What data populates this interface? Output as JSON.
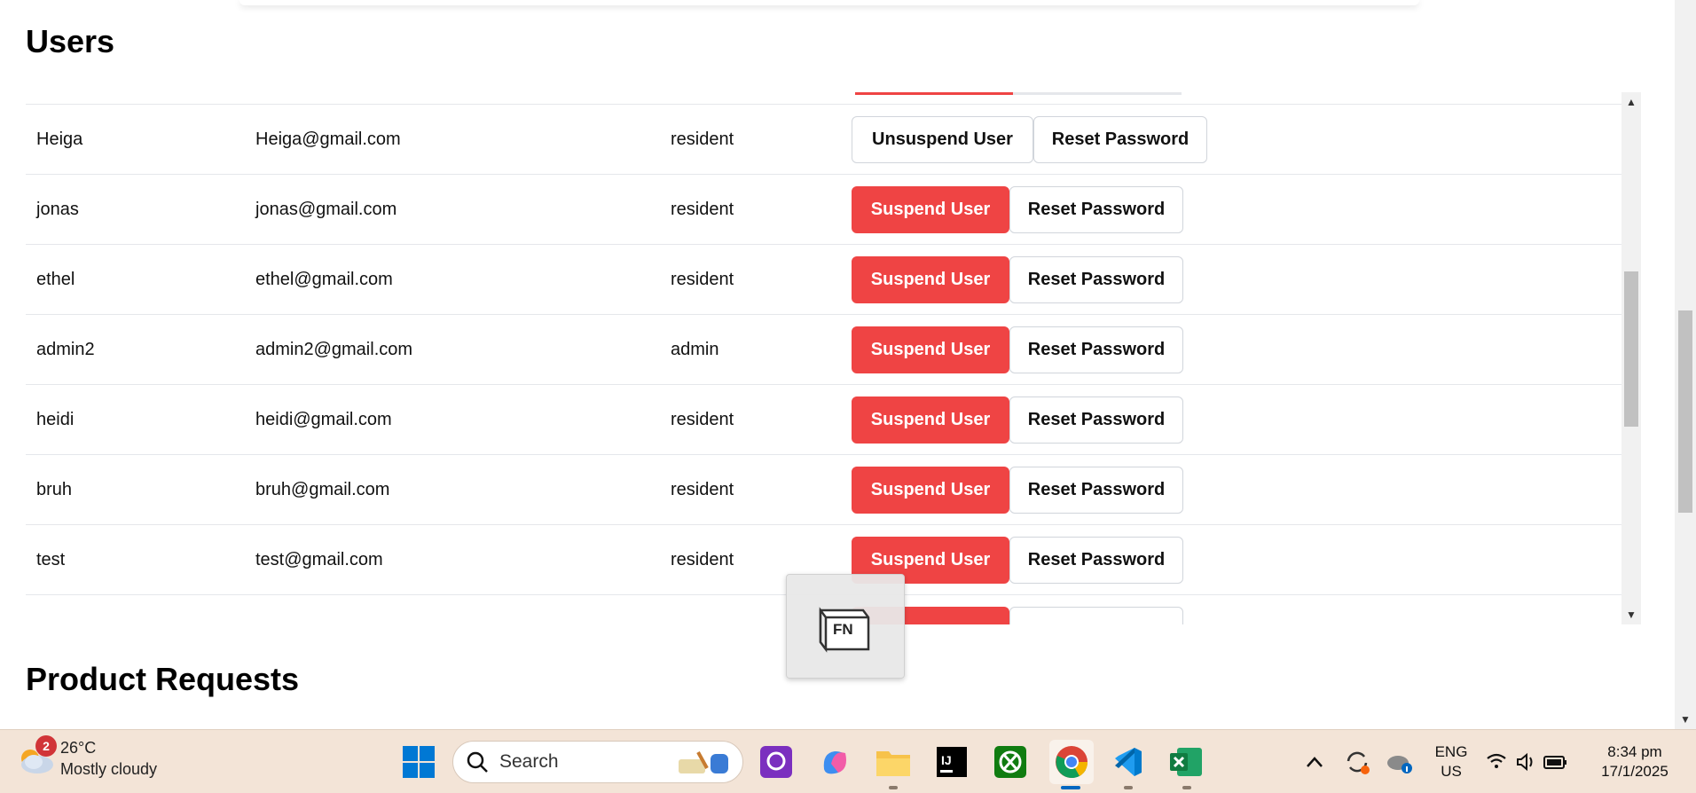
{
  "sections": {
    "users_title": "Users",
    "products_title": "Product Requests"
  },
  "users": [
    {
      "name": "Heiga",
      "email": "Heiga@gmail.com",
      "role": "resident",
      "primary_action": "Unsuspend User",
      "secondary_action": "Reset Password",
      "suspended": true
    },
    {
      "name": "jonas",
      "email": "jonas@gmail.com",
      "role": "resident",
      "primary_action": "Suspend User",
      "secondary_action": "Reset Password",
      "suspended": false
    },
    {
      "name": "ethel",
      "email": "ethel@gmail.com",
      "role": "resident",
      "primary_action": "Suspend User",
      "secondary_action": "Reset Password",
      "suspended": false
    },
    {
      "name": "admin2",
      "email": "admin2@gmail.com",
      "role": "admin",
      "primary_action": "Suspend User",
      "secondary_action": "Reset Password",
      "suspended": false
    },
    {
      "name": "heidi",
      "email": "heidi@gmail.com",
      "role": "resident",
      "primary_action": "Suspend User",
      "secondary_action": "Reset Password",
      "suspended": false
    },
    {
      "name": "bruh",
      "email": "bruh@gmail.com",
      "role": "resident",
      "primary_action": "Suspend User",
      "secondary_action": "Reset Password",
      "suspended": false
    },
    {
      "name": "test",
      "email": "test@gmail.com",
      "role": "resident",
      "primary_action": "Suspend User",
      "secondary_action": "Reset Password",
      "suspended": false
    }
  ],
  "overlay": {
    "key_label": "FN"
  },
  "taskbar": {
    "weather": {
      "badge": "2",
      "temp": "26°C",
      "condition": "Mostly cloudy"
    },
    "search_placeholder": "Search",
    "language": {
      "line1": "ENG",
      "line2": "US"
    },
    "clock": {
      "time": "8:34 pm",
      "date": "17/1/2025"
    }
  },
  "colors": {
    "suspend_red": "#ef4444",
    "taskbar_bg": "#f3e4d7",
    "accent_blue": "#0067c0"
  }
}
